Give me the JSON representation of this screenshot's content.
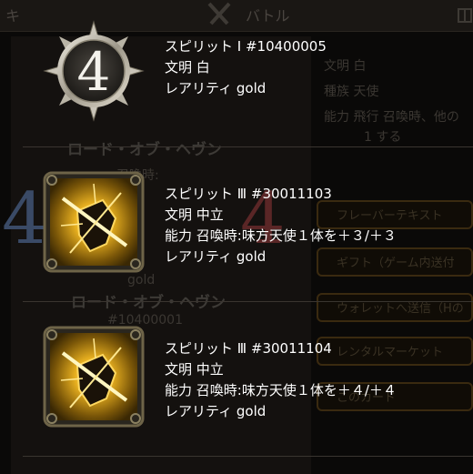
{
  "background": {
    "top_tabs": [
      "キ",
      "バトル"
    ],
    "panel_title": "ロード・オブ・ヘヴン",
    "panel_subtitle": "#10400001",
    "rarity": "gold",
    "panel_text_1": "召喚時:",
    "right_info": [
      "文明 白",
      "種族 天使",
      "能力 飛行 召喚時、他の",
      "1 する"
    ],
    "buttons": [
      "フレーバーテキスト",
      "ギフト（ゲーム内送付",
      "ウォレットへ送信（Hの",
      "レンタルマーケット",
      "このカード"
    ]
  },
  "entries": [
    {
      "icon": "number-4-emblem-icon",
      "name": "スピリット Ⅰ #10400005",
      "civ": "文明 白",
      "ability": "",
      "rarity": "レアリティ gold"
    },
    {
      "icon": "golden-shield-slash-icon",
      "name": "スピリット Ⅲ #30011103",
      "civ": "文明 中立",
      "ability": "能力 召喚時:味方天使１体を＋３/＋３",
      "rarity": "レアリティ gold"
    },
    {
      "icon": "golden-shield-slash-icon",
      "name": "スピリット Ⅲ #30011104",
      "civ": "文明 中立",
      "ability": "能力 召喚時:味方天使１体を＋４/＋４",
      "rarity": "レアリティ gold"
    }
  ],
  "colors": {
    "gold": "#e8b020",
    "icon_frame": "#6e6448",
    "emblem_silver": "#c9c4b8"
  }
}
